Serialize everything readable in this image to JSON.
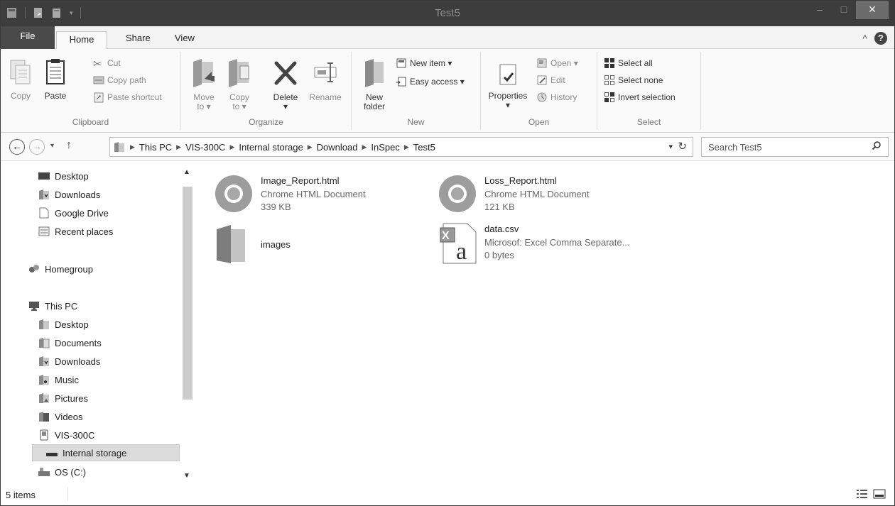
{
  "window": {
    "title": "Test5",
    "controls": {
      "minimize": "–",
      "maximize": "□",
      "close": "✕"
    }
  },
  "ribbon_tabs": {
    "file": "File",
    "home": "Home",
    "share": "Share",
    "view": "View",
    "collapse_icon": "^",
    "help": "?"
  },
  "clipboard": {
    "group_label": "Clipboard",
    "copy": "Copy",
    "paste": "Paste",
    "cut": "Cut",
    "copy_path": "Copy path",
    "paste_shortcut": "Paste shortcut"
  },
  "organize": {
    "group_label": "Organize",
    "move_to": "Move",
    "move_to_2": "to ▾",
    "copy_to": "Copy",
    "copy_to_2": "to ▾",
    "delete": "Delete",
    "delete_arrow": "▾",
    "rename": "Rename"
  },
  "new": {
    "group_label": "New",
    "new_folder": "New",
    "new_folder_2": "folder",
    "new_item": "New item ▾",
    "easy_access": "Easy access ▾"
  },
  "open": {
    "group_label": "Open",
    "properties": "Properties",
    "properties_arrow": "▾",
    "open": "Open ▾",
    "edit": "Edit",
    "history": "History"
  },
  "select": {
    "group_label": "Select",
    "select_all": "Select all",
    "select_none": "Select none",
    "invert_selection": "Invert selection"
  },
  "address": {
    "back": "←",
    "forward": "→",
    "recent": "▾",
    "up": "↑",
    "breadcrumbs": [
      "This PC",
      "VIS-300C",
      "Internal storage",
      "Download",
      "InSpec",
      "Test5"
    ],
    "dropdown": "▾",
    "refresh": "↻"
  },
  "search": {
    "placeholder": "Search Test5",
    "icon": "search-icon"
  },
  "nav_pane": {
    "favorites": [
      "Desktop",
      "Downloads",
      "Google Drive",
      "Recent places"
    ],
    "homegroup": "Homegroup",
    "this_pc": "This PC",
    "this_pc_children": [
      "Desktop",
      "Documents",
      "Downloads",
      "Music",
      "Pictures",
      "Videos",
      "VIS-300C"
    ],
    "selected": "Internal storage",
    "os": "OS (C:)",
    "scroll_up": "▲",
    "scroll_down": "▼"
  },
  "files": [
    {
      "name": "Image_Report.html",
      "type": "Chrome HTML Document",
      "size": "339 KB",
      "icon": "chrome-icon"
    },
    {
      "name": "Loss_Report.html",
      "type": "Chrome HTML Document",
      "size": "121 KB",
      "icon": "chrome-icon"
    },
    {
      "name": "images",
      "type": "",
      "size": "",
      "icon": "folder-icon"
    },
    {
      "name": "data.csv",
      "type": "Microsof: Excel Comma Separate...",
      "size": "0 bytes",
      "icon": "csv-icon"
    }
  ],
  "status": {
    "item_count": "5 items"
  },
  "colors": {
    "titlebar": "#3d3d3d",
    "file_tab": "#4a4a4a",
    "selected": "#dcdcdc"
  }
}
